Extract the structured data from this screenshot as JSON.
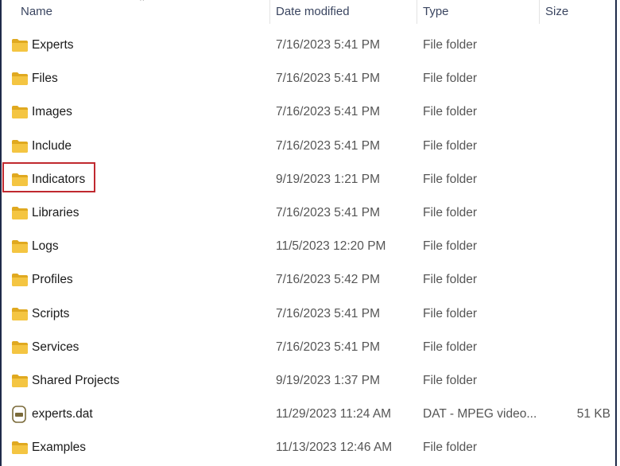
{
  "header": {
    "name": "Name",
    "date_modified": "Date modified",
    "type": "Type",
    "size": "Size"
  },
  "rows": [
    {
      "name": "Experts",
      "date": "7/16/2023 5:41 PM",
      "type": "File folder",
      "size": "",
      "icon": "folder-icon"
    },
    {
      "name": "Files",
      "date": "7/16/2023 5:41 PM",
      "type": "File folder",
      "size": "",
      "icon": "folder-icon"
    },
    {
      "name": "Images",
      "date": "7/16/2023 5:41 PM",
      "type": "File folder",
      "size": "",
      "icon": "folder-icon"
    },
    {
      "name": "Include",
      "date": "7/16/2023 5:41 PM",
      "type": "File folder",
      "size": "",
      "icon": "folder-icon"
    },
    {
      "name": "Indicators",
      "date": "9/19/2023 1:21 PM",
      "type": "File folder",
      "size": "",
      "icon": "folder-icon"
    },
    {
      "name": "Libraries",
      "date": "7/16/2023 5:41 PM",
      "type": "File folder",
      "size": "",
      "icon": "folder-icon"
    },
    {
      "name": "Logs",
      "date": "11/5/2023 12:20 PM",
      "type": "File folder",
      "size": "",
      "icon": "folder-icon"
    },
    {
      "name": "Profiles",
      "date": "7/16/2023 5:42 PM",
      "type": "File folder",
      "size": "",
      "icon": "folder-icon"
    },
    {
      "name": "Scripts",
      "date": "7/16/2023 5:41 PM",
      "type": "File folder",
      "size": "",
      "icon": "folder-icon"
    },
    {
      "name": "Services",
      "date": "7/16/2023 5:41 PM",
      "type": "File folder",
      "size": "",
      "icon": "folder-icon"
    },
    {
      "name": "Shared Projects",
      "date": "9/19/2023 1:37 PM",
      "type": "File folder",
      "size": "",
      "icon": "folder-icon"
    },
    {
      "name": "experts.dat",
      "date": "11/29/2023 11:24 AM",
      "type": "DAT - MPEG video...",
      "size": "51 KB",
      "icon": "dat-file-icon"
    },
    {
      "name": "Examples",
      "date": "11/13/2023 12:46 AM",
      "type": "File folder",
      "size": "",
      "icon": "folder-icon"
    }
  ],
  "colors": {
    "folder": "#f4c542",
    "folder_dark": "#e0a920",
    "highlight": "#c0292f",
    "header_text": "#3a4560"
  }
}
